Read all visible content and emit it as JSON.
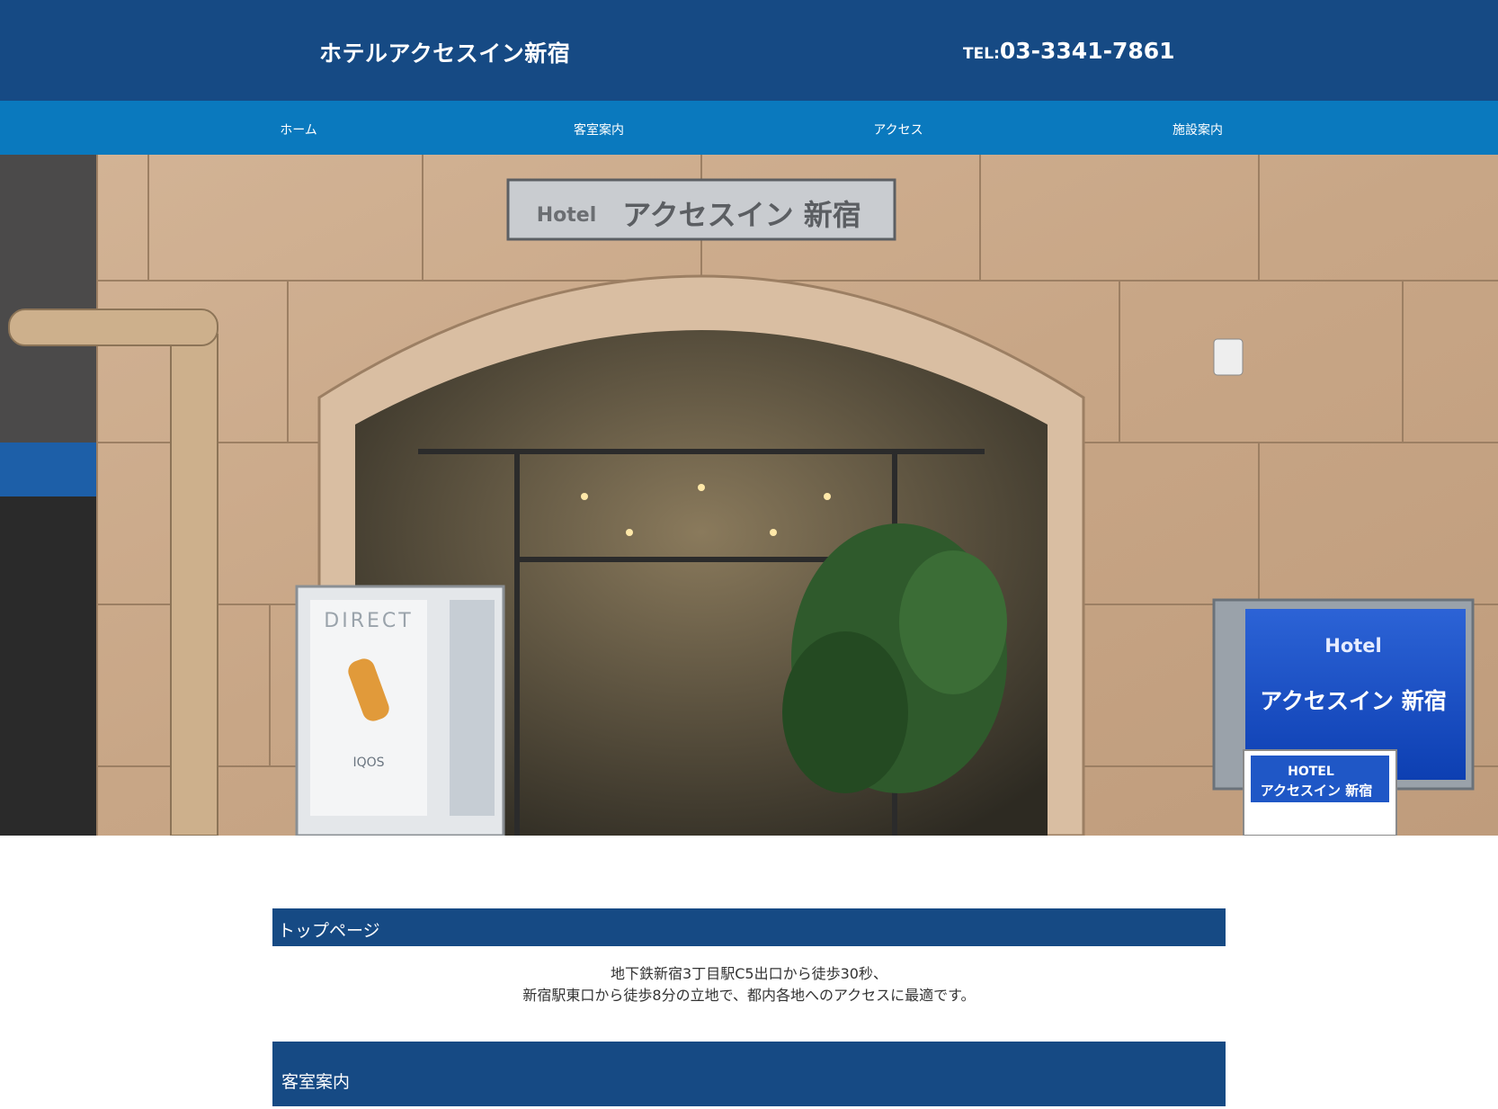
{
  "header": {
    "site_title": "ホテルアクセスイン新宿",
    "tel_prefix": "TEL:",
    "tel_number": "03-3341-7861"
  },
  "nav": {
    "items": [
      {
        "label": "ホーム"
      },
      {
        "label": "客室案内"
      },
      {
        "label": "アクセス"
      },
      {
        "label": "施設案内"
      }
    ]
  },
  "hero": {
    "signs": {
      "plate_hotel": "Hotel",
      "plate_name": "アクセスイン 新宿",
      "side_hotel": "Hotel",
      "side_name": "アクセスイン 新宿",
      "small_hotel": "HOTEL",
      "small_name": "アクセスイン 新宿",
      "vending_brand": "DIRECT",
      "vending_product": "IQOS"
    }
  },
  "sections": {
    "top_page": {
      "heading": "トップページ",
      "lines": [
        "地下鉄新宿3丁目駅C5出口から徒歩30秒、",
        "新宿駅東口から徒歩8分の立地で、都内各地へのアクセスに最適です。"
      ]
    },
    "rooms": {
      "heading": "客室案内"
    }
  },
  "colors": {
    "header_bg": "#164a84",
    "nav_bg": "#0a79be",
    "section_bar_bg": "#164a84"
  }
}
